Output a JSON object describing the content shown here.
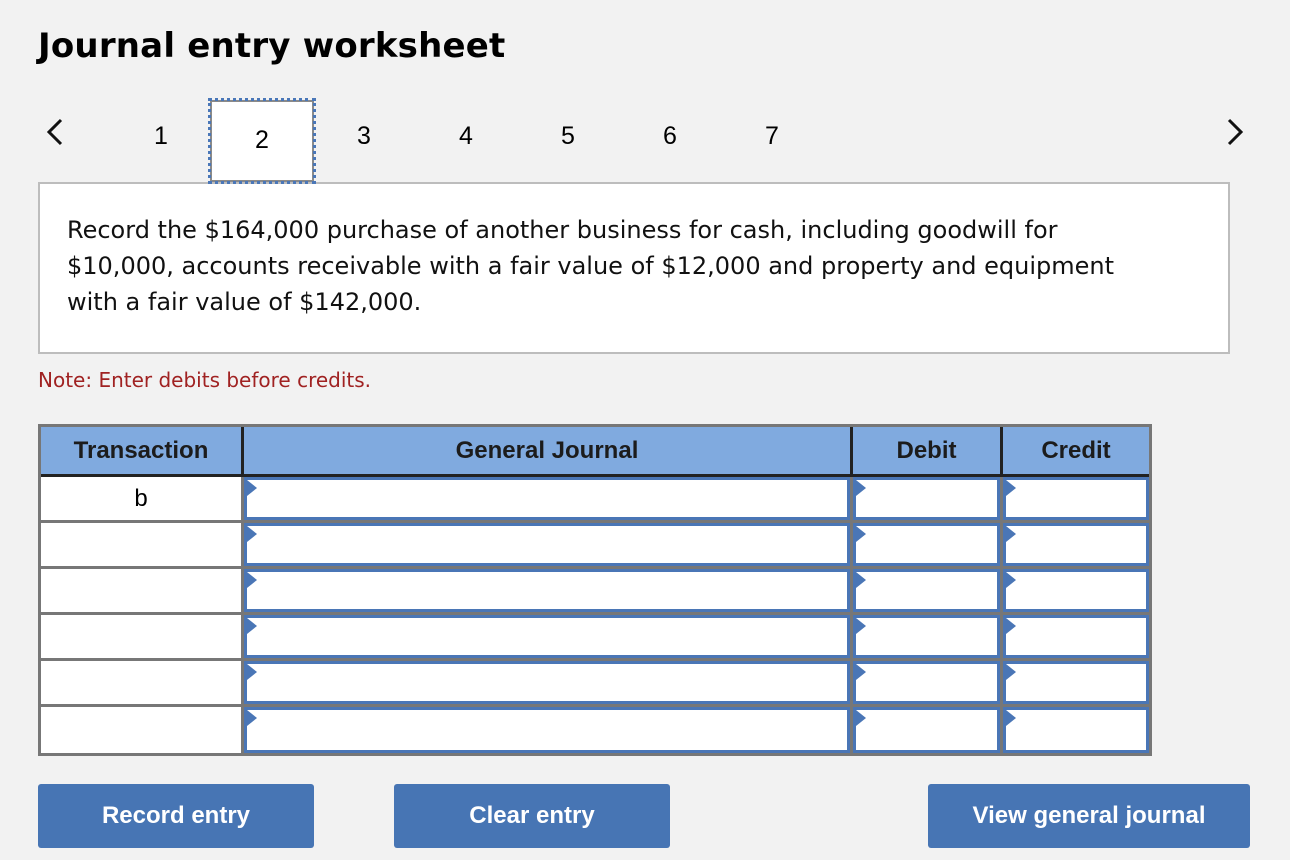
{
  "page": {
    "title": "Journal entry worksheet"
  },
  "pager": {
    "prev_icon": "chevron-left-icon",
    "next_icon": "chevron-right-icon",
    "pages": [
      "1",
      "2",
      "3",
      "4",
      "5",
      "6",
      "7"
    ],
    "active_page": "2"
  },
  "prompt": {
    "text": "Record the $164,000 purchase of another business for cash, including goodwill for $10,000, accounts receivable with a fair value of $12,000 and property and equipment with a fair value of $142,000."
  },
  "note": {
    "text": "Note: Enter debits before credits."
  },
  "table": {
    "headers": {
      "transaction": "Transaction",
      "general_journal": "General Journal",
      "debit": "Debit",
      "credit": "Credit"
    },
    "rows": [
      {
        "transaction": "b",
        "account": "",
        "debit": "",
        "credit": ""
      },
      {
        "transaction": "",
        "account": "",
        "debit": "",
        "credit": ""
      },
      {
        "transaction": "",
        "account": "",
        "debit": "",
        "credit": ""
      },
      {
        "transaction": "",
        "account": "",
        "debit": "",
        "credit": ""
      },
      {
        "transaction": "",
        "account": "",
        "debit": "",
        "credit": ""
      },
      {
        "transaction": "",
        "account": "",
        "debit": "",
        "credit": ""
      }
    ]
  },
  "buttons": {
    "record": "Record entry",
    "clear": "Clear entry",
    "view": "View general journal"
  },
  "colors": {
    "accent": "#4775b4",
    "header_bg": "#80aadf",
    "note_text": "#a02222",
    "background": "#f2f2f2"
  }
}
